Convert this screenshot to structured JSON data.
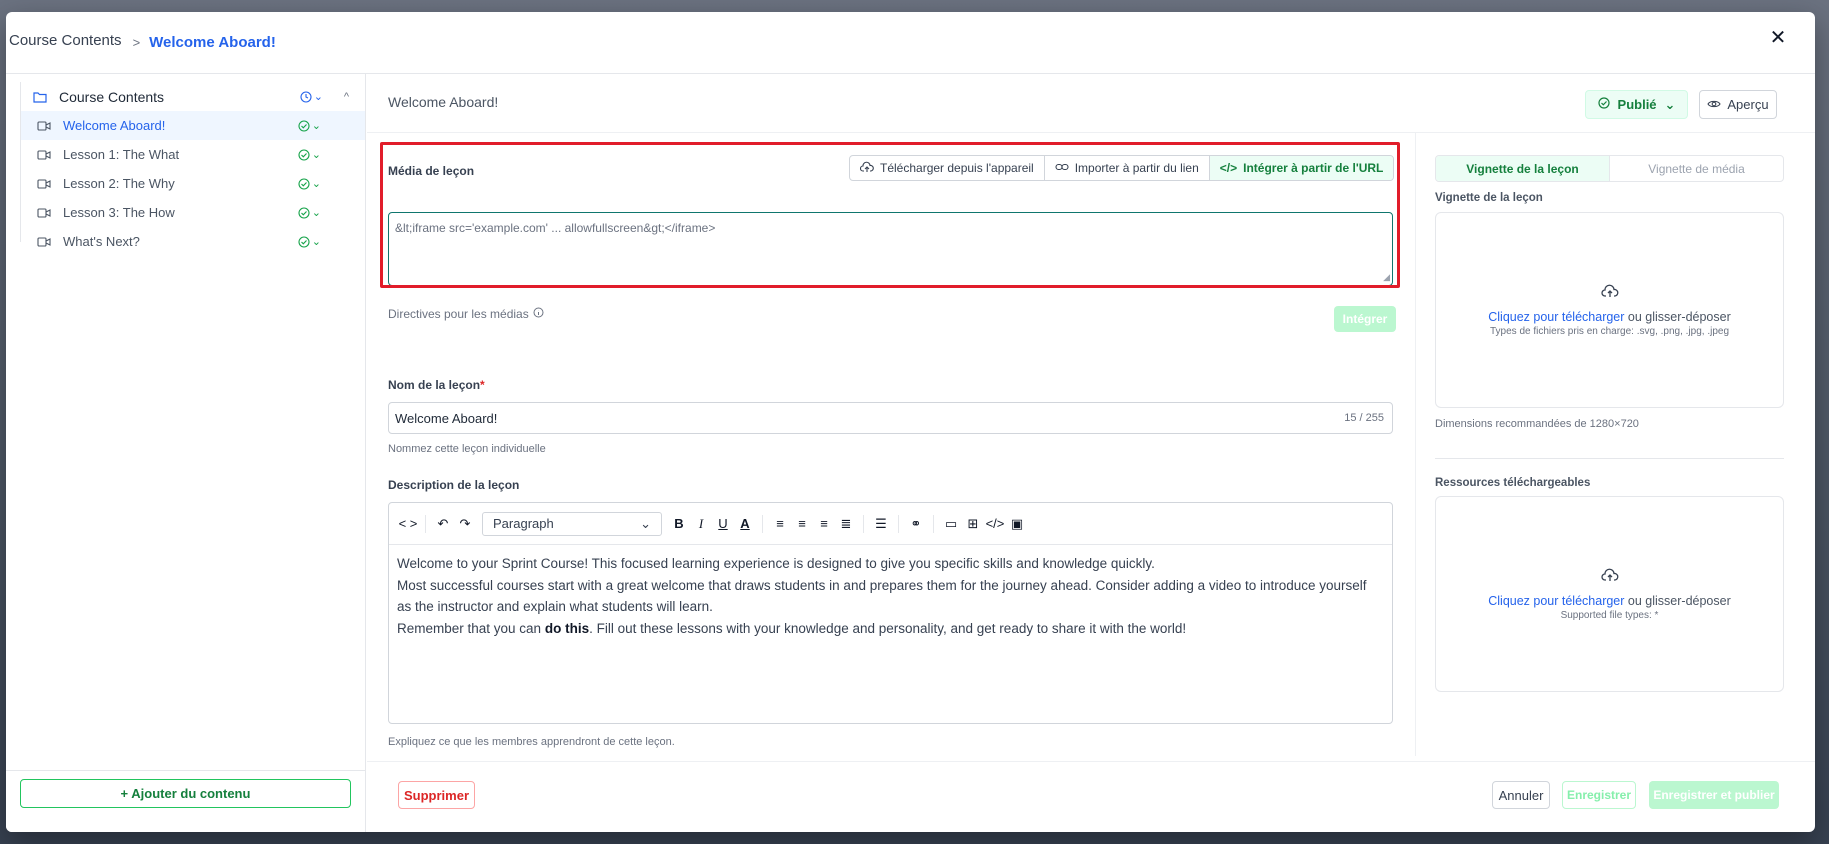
{
  "breadcrumb": {
    "root": "Course Contents",
    "separator": ">",
    "current": "Welcome Aboard!"
  },
  "sidebar": {
    "root_label": "Course Contents",
    "items": [
      {
        "label": "Welcome Aboard!",
        "active": true
      },
      {
        "label": "Lesson 1: The What",
        "active": false
      },
      {
        "label": "Lesson 2: The Why",
        "active": false
      },
      {
        "label": "Lesson 3: The How",
        "active": false
      },
      {
        "label": "What's Next?",
        "active": false
      }
    ],
    "add_content_label": "+ Ajouter du contenu"
  },
  "main": {
    "title": "Welcome Aboard!",
    "publish_label": "Publié",
    "preview_label": "Aperçu",
    "media_label": "Média de leçon",
    "media_tabs": [
      {
        "label": "Télécharger depuis l'appareil",
        "icon": "upload-cloud-icon"
      },
      {
        "label": "Importer à partir du lien",
        "icon": "link-icon"
      },
      {
        "label": "Intégrer à partir de l'URL",
        "icon": "code-icon",
        "active": true
      }
    ],
    "embed_value": "&lt;iframe src='example.com' ... allowfullscreen&gt;</iframe>",
    "media_guidelines": "Directives pour les médias",
    "integrate_label": "Intégrer",
    "name_label": "Nom de la leçon",
    "name_required": "*",
    "name_value": "Welcome Aboard!",
    "name_counter": "15 / 255",
    "name_helper": "Nommez cette leçon individuelle",
    "description_label": "Description de la leçon",
    "paragraph_select": "Paragraph",
    "description": {
      "line1": "Welcome to your Sprint Course! This focused learning experience is designed to give you specific skills and knowledge quickly.",
      "line2": "Most successful courses start with a great welcome that draws students in and prepares them for the journey ahead. Consider adding a video to introduce yourself as the instructor and explain what students will learn.",
      "line3_before": "Remember that you can ",
      "line3_bold": "do this",
      "line3_after": ". Fill out these lessons with your knowledge and personality, and get ready to share it with the world!"
    },
    "description_helper": "Expliquez ce que les membres apprendront de cette leçon."
  },
  "right": {
    "tabs": [
      "Vignette de la leçon",
      "Vignette de média"
    ],
    "thumb_label": "Vignette de la leçon",
    "thumb_click": "Cliquez pour télécharger",
    "thumb_or": " ou glisser-déposer",
    "thumb_types": "Types de fichiers pris en charge: .svg, .png, .jpg, .jpeg",
    "thumb_dimensions": "Dimensions recommandées de 1280×720",
    "resources_label": "Ressources téléchargeables",
    "res_click": "Cliquez pour télécharger",
    "res_or": " ou glisser-déposer",
    "res_types": "Supported file types: *"
  },
  "footer": {
    "delete_label": "Supprimer",
    "cancel_label": "Annuler",
    "save_label": "Enregistrer",
    "save_publish_label": "Enregistrer et publier"
  },
  "colors": {
    "accent": "#2563eb",
    "success": "#15803d",
    "danger": "#dc2626",
    "highlight": "#e11d2a"
  }
}
